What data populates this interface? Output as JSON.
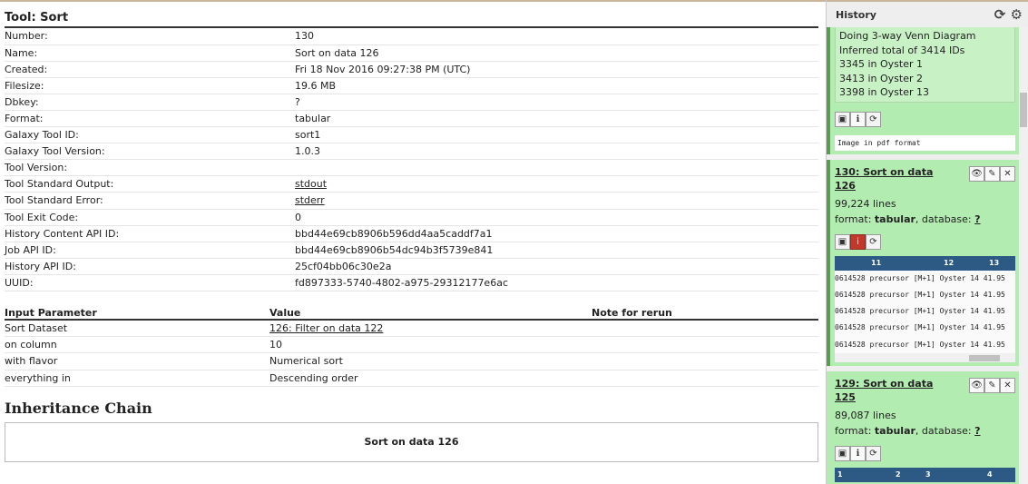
{
  "tool": {
    "title": "Tool: Sort",
    "info_rows": [
      {
        "key": "Number:",
        "value": "130"
      },
      {
        "key": "Name:",
        "value": "Sort on data 126"
      },
      {
        "key": "Created:",
        "value": "Fri 18 Nov 2016 09:27:38 PM (UTC)"
      },
      {
        "key": "Filesize:",
        "value": "19.6 MB"
      },
      {
        "key": "Dbkey:",
        "value": "?"
      },
      {
        "key": "Format:",
        "value": "tabular"
      },
      {
        "key": "Galaxy Tool ID:",
        "value": "sort1"
      },
      {
        "key": "Galaxy Tool Version:",
        "value": "1.0.3"
      },
      {
        "key": "Tool Version:",
        "value": ""
      },
      {
        "key": "Tool Standard Output:",
        "value": "stdout"
      },
      {
        "key": "Tool Standard Error:",
        "value": "stderr"
      },
      {
        "key": "Tool Exit Code:",
        "value": "0"
      },
      {
        "key": "History Content API ID:",
        "value": "bbd44e69cb8906b596dd4aa5caddf7a1"
      },
      {
        "key": "Job API ID:",
        "value": "bbd44e69cb8906b54dc94b3f5739e841"
      },
      {
        "key": "History API ID:",
        "value": "25cf04bb06c30e2a"
      },
      {
        "key": "UUID:",
        "value": "fd897333-5740-4802-a975-29312177e6ac"
      }
    ]
  },
  "params": {
    "headers": [
      "Input Parameter",
      "Value",
      "Note for rerun"
    ],
    "rows": [
      {
        "name": "Sort Dataset",
        "value": "126: Filter on data 122"
      },
      {
        "name": "on column",
        "value": "10"
      },
      {
        "name": "with flavor",
        "value": "Numerical sort"
      },
      {
        "name": "everything in",
        "value": "Descending order"
      }
    ]
  },
  "inheritance": {
    "title": "Inheritance Chain",
    "item": "Sort on data 126"
  },
  "history": {
    "title": "History",
    "refresh_icon": "refresh-icon",
    "settings_icon": "gear-icon",
    "peek_lines": [
      "Doing 3-way Venn Diagram",
      "Inferred total of 3414 IDs",
      "3345 in Oyster 1",
      "3413 in Oyster 2",
      "3398 in Oyster 13"
    ],
    "pdf_label": "Image in pdf format",
    "datasets": [
      {
        "title": "130: Sort on data 126",
        "lines": "99,224 lines",
        "format_label": "format: ",
        "format": "tabular",
        "db_label": ", database: ",
        "db": "?",
        "peek_cols": [
          "11",
          "12",
          "13"
        ],
        "peek_rows": [
          "0614528 precursor [M+1] Oyster 14 41.95",
          "0614528 precursor [M+1] Oyster 14 41.95",
          "0614528 precursor [M+1] Oyster 14 41.95",
          "0614528 precursor [M+1] Oyster 14 41.95",
          "0614528 precursor [M+1] Oyster 14 41.95"
        ]
      },
      {
        "title": "129: Sort on data 125",
        "lines": "89,087 lines",
        "format_label": "format: ",
        "format": "tabular",
        "db_label": ", database: ",
        "db": "?",
        "peek_cols": [
          "1",
          "2",
          "3",
          "4"
        ]
      }
    ]
  }
}
